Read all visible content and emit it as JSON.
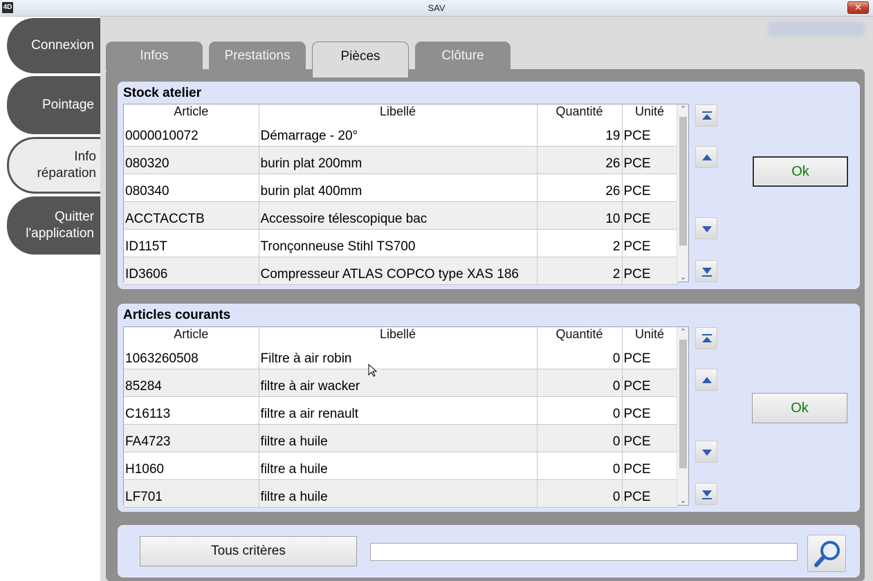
{
  "window": {
    "title": "SAV",
    "app_icon": "4D",
    "close_label": "✕"
  },
  "nav": {
    "items": [
      {
        "label": "Connexion"
      },
      {
        "label": "Pointage"
      },
      {
        "label": "Info réparation"
      },
      {
        "label": "Quitter l'application"
      }
    ]
  },
  "tabs": [
    {
      "label": "Infos"
    },
    {
      "label": "Prestations"
    },
    {
      "label": "Pièces"
    },
    {
      "label": "Clôture"
    }
  ],
  "stock": {
    "title": "Stock atelier",
    "columns": [
      "Article",
      "Libellé",
      "Quantité",
      "Unité"
    ],
    "rows": [
      [
        "0000010072",
        "Démarrage - 20°",
        "19",
        "PCE"
      ],
      [
        "080320",
        "burin plat 200mm",
        "26",
        "PCE"
      ],
      [
        "080340",
        "burin plat 400mm",
        "26",
        "PCE"
      ],
      [
        "ACCTACCTB",
        "Accessoire télescopique bac",
        "10",
        "PCE"
      ],
      [
        "ID115T",
        "Tronçonneuse Stihl TS700",
        "2",
        "PCE"
      ],
      [
        "ID3606",
        "Compresseur ATLAS COPCO type XAS 186",
        "2",
        "PCE"
      ]
    ],
    "ok_label": "Ok"
  },
  "courants": {
    "title": "Articles courants",
    "columns": [
      "Article",
      "Libellé",
      "Quantité",
      "Unité"
    ],
    "rows": [
      [
        "1063260508",
        "Filtre à air robin",
        "0",
        "PCE"
      ],
      [
        "85284",
        "filtre à air wacker",
        "0",
        "PCE"
      ],
      [
        "C16113",
        "filtre a air renault",
        "0",
        "PCE"
      ],
      [
        "FA4723",
        "filtre a huile",
        "0",
        "PCE"
      ],
      [
        "H1060",
        "filtre a huile",
        "0",
        "PCE"
      ],
      [
        "LF701",
        "filtre a huile",
        "0",
        "PCE"
      ]
    ],
    "ok_label": "Ok"
  },
  "search": {
    "criteria_label": "Tous critères",
    "value": "",
    "icon": "magnifier-icon"
  },
  "colors": {
    "nav_dark": "#555555",
    "tab_inactive": "#8f8f8f",
    "panel_bg": "#dde4fa",
    "ok_text": "#0a7d0a",
    "close_red": "#c4472f"
  }
}
